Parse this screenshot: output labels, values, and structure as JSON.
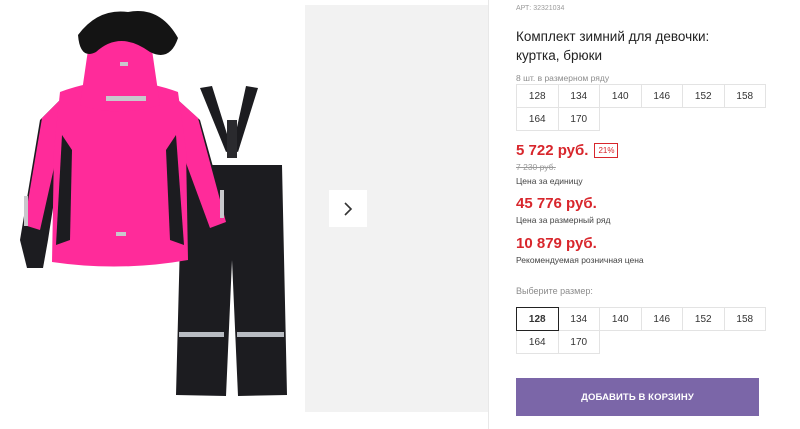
{
  "product": {
    "article": "АРТ: 32321034",
    "title": "Комплект зимний для девочки: куртка, брюки"
  },
  "pack": {
    "label": "8 шт. в размерном ряду",
    "sizes": [
      "128",
      "134",
      "140",
      "146",
      "152",
      "158",
      "164",
      "170"
    ]
  },
  "prices": {
    "unit_price": "5 722 руб.",
    "discount_badge": "21%",
    "old_price": "7 230 руб.",
    "unit_note": "Цена за единицу",
    "row_price": "45 776 руб.",
    "row_note": "Цена за размерный ряд",
    "rrp_price": "10 879 руб.",
    "rrp_note": "Рекомендуемая розничная цена"
  },
  "size_select": {
    "label": "Выберите размер:",
    "options": [
      "128",
      "134",
      "140",
      "146",
      "152",
      "158",
      "164",
      "170"
    ],
    "selected": "128"
  },
  "actions": {
    "add_to_cart": "ДОБАВИТЬ В КОРЗИНУ"
  },
  "colors": {
    "accent": "#7b66a8",
    "price": "#d8262c",
    "jacket": "#ff2b9a",
    "pants": "#1c1c20"
  },
  "icons": {
    "next": "chevron-right-icon"
  }
}
